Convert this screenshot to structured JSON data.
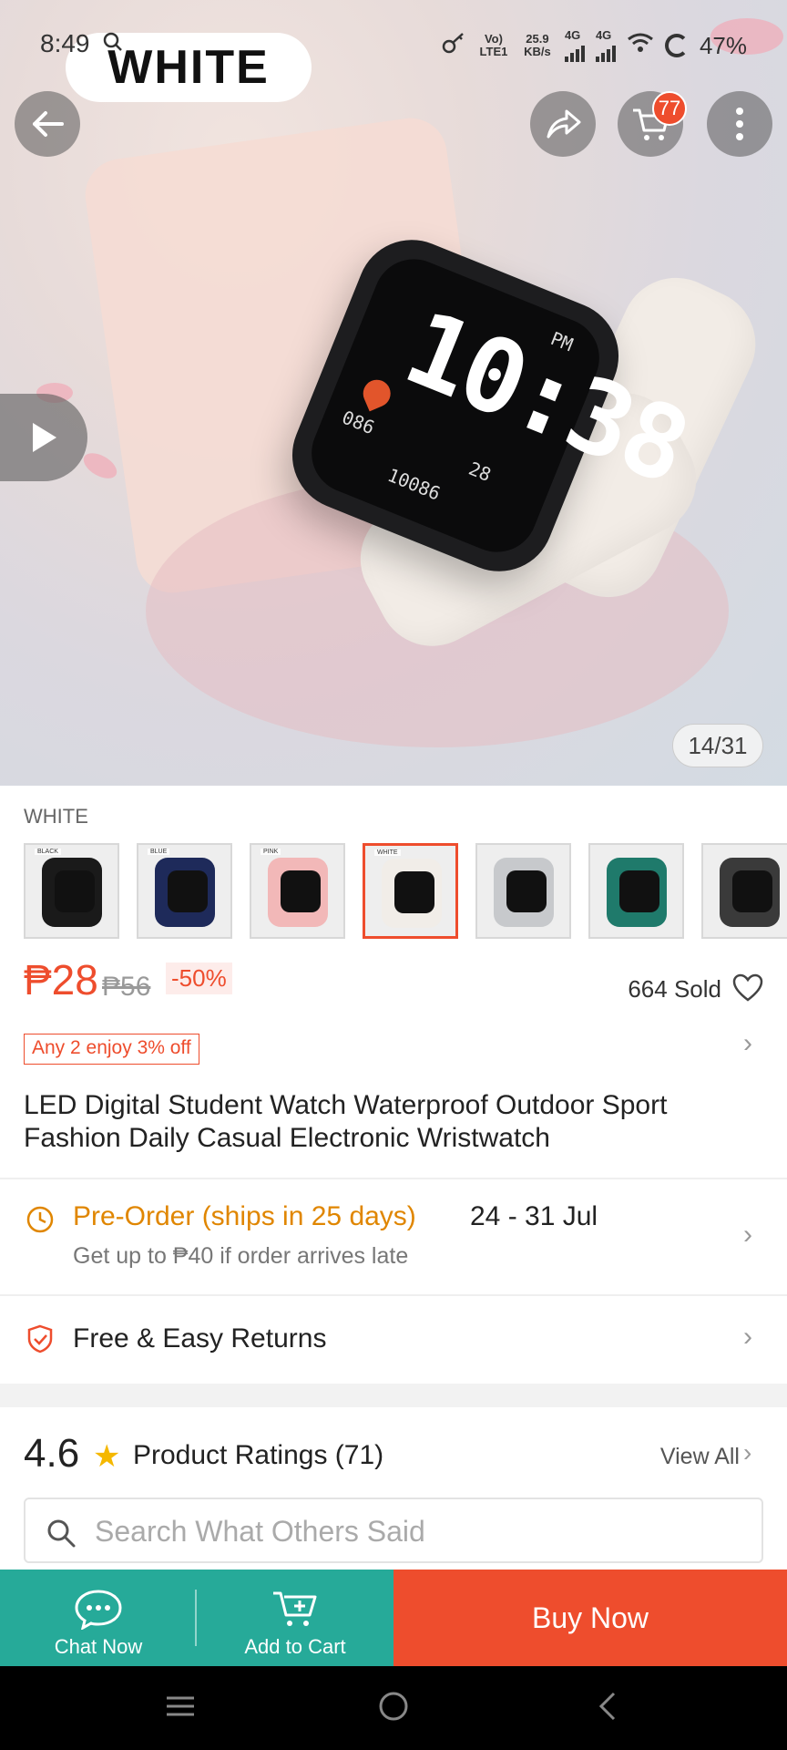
{
  "status_bar": {
    "time": "8:49",
    "volte": "Vo) LTE1",
    "speed": "25.9 KB/s",
    "net1": "4G",
    "net2": "4G",
    "battery": "47%"
  },
  "hero": {
    "variant_overlay": "WHITE",
    "cart_count": "77",
    "image_counter": "14/31",
    "watch_time": "10:38",
    "watch_meta_a": "PM",
    "watch_meta_b": "086",
    "watch_meta_c": "28",
    "watch_steps": "10086"
  },
  "variants": {
    "title": "WHITE",
    "items": [
      {
        "tag": "BLACK",
        "band_color": "#1a1a1a",
        "selected": false
      },
      {
        "tag": "BLUE",
        "band_color": "#1e2a5a",
        "selected": false
      },
      {
        "tag": "PINK",
        "band_color": "#f2b8b8",
        "selected": false
      },
      {
        "tag": "WHITE",
        "band_color": "#f1ede8",
        "selected": true
      },
      {
        "tag": "",
        "band_color": "#c7c9cc",
        "selected": false
      },
      {
        "tag": "",
        "band_color": "#1f7a6b",
        "selected": false
      },
      {
        "tag": "",
        "band_color": "#3a3a3a",
        "selected": false
      }
    ]
  },
  "product": {
    "price": "₱28",
    "original_price": "₱56",
    "discount": "-50%",
    "sold": "664 Sold",
    "promo": "Any 2 enjoy 3% off",
    "title": "LED Digital Student Watch Waterproof Outdoor Sport Fashion Daily Casual Electronic Wristwatch"
  },
  "shipping": {
    "preorder": "Pre-Order (ships in 25 days)",
    "date_range": "24 - 31 Jul",
    "late_note": "Get up to ₱40 if order arrives late",
    "returns": "Free & Easy Returns"
  },
  "ratings": {
    "score": "4.6",
    "label": "Product Ratings (71)",
    "view_all": "View All",
    "search_placeholder": "Search What Others Said"
  },
  "bottom_bar": {
    "chat": "Chat Now",
    "add_to_cart": "Add to Cart",
    "buy_now": "Buy Now"
  },
  "colors": {
    "accent": "#ee4d2d",
    "teal": "#26aa99",
    "preorder": "#e08600",
    "star": "#f5b800"
  }
}
